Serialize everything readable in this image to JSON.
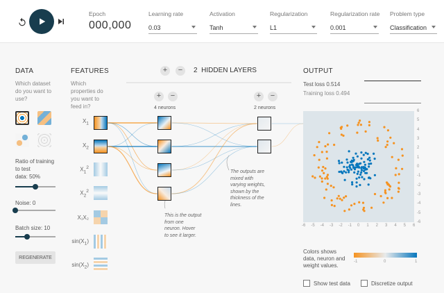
{
  "controls": {
    "epoch_label": "Epoch",
    "epoch_value": "000,000",
    "learning_rate_label": "Learning rate",
    "learning_rate_value": "0.03",
    "activation_label": "Activation",
    "activation_value": "Tanh",
    "regularization_label": "Regularization",
    "regularization_value": "L1",
    "reg_rate_label": "Regularization rate",
    "reg_rate_value": "0.001",
    "problem_label": "Problem type",
    "problem_value": "Classification"
  },
  "data_panel": {
    "title": "DATA",
    "subtitle": [
      "Which dataset",
      "do you want to",
      "use?"
    ],
    "ratio_label": [
      "Ratio of training",
      "to test"
    ],
    "ratio_value_text": "data:  50%",
    "ratio_fraction": 0.5,
    "noise_text": "Noise:  0",
    "noise_fraction": 0.0,
    "batch_text": "Batch size:  10",
    "batch_fraction": 0.3,
    "regenerate_label": "REGENERATE"
  },
  "features_panel": {
    "title": "FEATURES",
    "subtitle": [
      "Which",
      "properties do",
      "you want to",
      "feed in?"
    ],
    "items": [
      {
        "main": "X",
        "sub": "1",
        "sup": "",
        "active": true
      },
      {
        "main": "X",
        "sub": "2",
        "sup": "",
        "active": true
      },
      {
        "main": "X",
        "sub": "1",
        "sup": "2",
        "active": false
      },
      {
        "main": "X",
        "sub": "2",
        "sup": "2",
        "active": false
      },
      {
        "main": "X₁X₂",
        "sub": "",
        "sup": "",
        "active": false
      },
      {
        "main": "sin(X",
        "sub": "1",
        "sup": "",
        "suffix": ")",
        "active": false
      },
      {
        "main": "sin(X",
        "sub": "2",
        "sup": "",
        "suffix": ")",
        "active": false
      }
    ]
  },
  "network": {
    "hidden_layers_count": "2",
    "hidden_layers_label": "HIDDEN LAYERS",
    "layer1_label": "4 neurons",
    "layer2_label": "2 neurons",
    "plus_symbol": "+",
    "minus_symbol": "−",
    "note_left": [
      "This is the output",
      "from one",
      "neuron. Hover",
      "to see it larger."
    ],
    "note_right": [
      "The outputs are",
      "mixed with",
      "varying weights,",
      "shown by the",
      "thickness of the",
      "lines."
    ]
  },
  "output_panel": {
    "title": "OUTPUT",
    "test_loss": "Test loss 0.514",
    "training_loss": "Training loss 0.494",
    "y_ticks": [
      "6",
      "5",
      "4",
      "3",
      "2",
      "1",
      "0",
      "-1",
      "-2",
      "-3",
      "-4",
      "-5",
      "-6"
    ],
    "x_ticks": [
      "-6",
      "-5",
      "-4",
      "-3",
      "-2",
      "-1",
      "0",
      "1",
      "2",
      "3",
      "4",
      "5",
      "6"
    ],
    "legend_text": [
      "Colors shows",
      "data, neuron and",
      "weight values."
    ],
    "legend_min": "-1",
    "legend_mid": "0",
    "legend_max": "1",
    "show_test_label": "Show test data",
    "discretize_label": "Discretize output",
    "colors": {
      "positive": "#0877bd",
      "negative": "#f59322",
      "neutral": "#e8eaeb"
    }
  }
}
